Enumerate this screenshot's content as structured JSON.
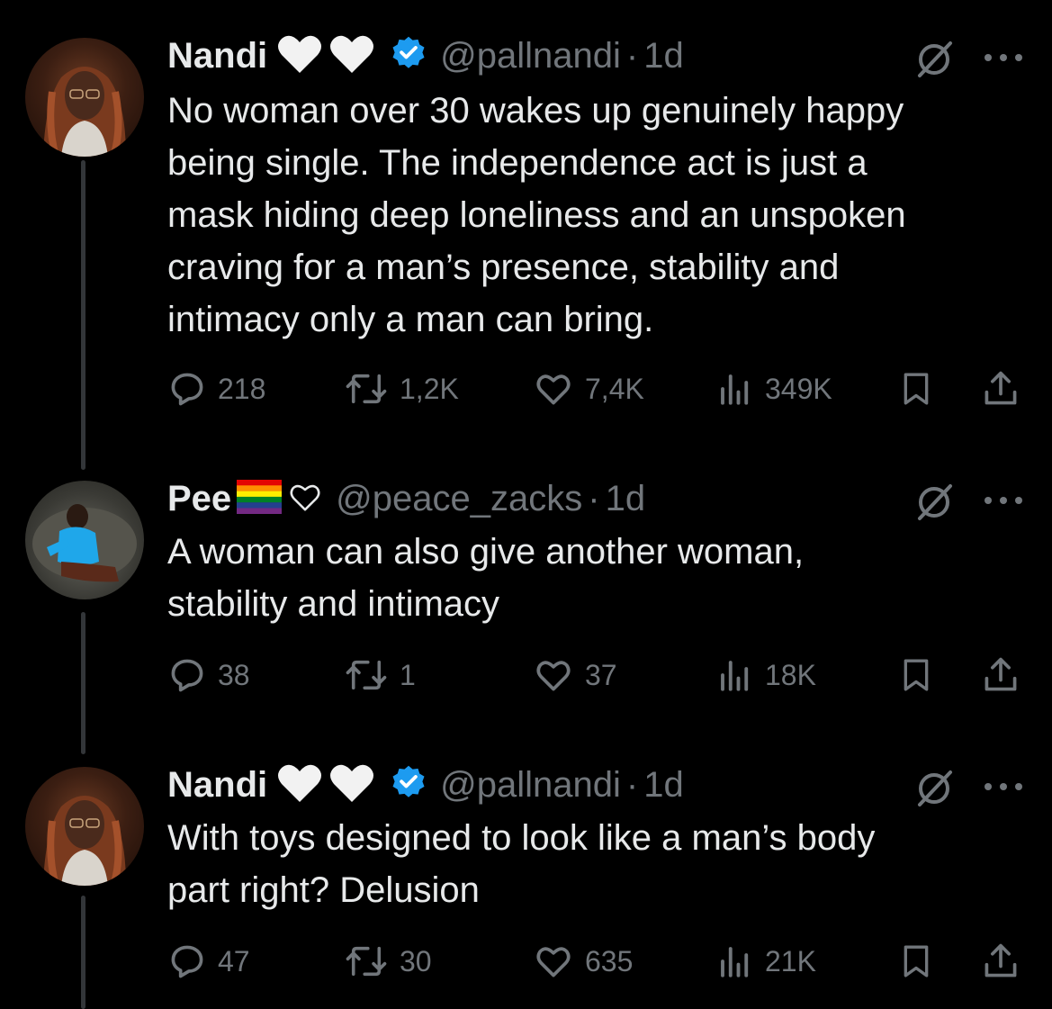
{
  "tweets": [
    {
      "author": "Nandi",
      "handle": "@pallnandi",
      "separator": "·",
      "time": "1d",
      "text": "No woman over 30 wakes up genuinely happy\nbeing single. The independence act is just a\nmask hiding deep loneliness and an unspoken\ncraving for a man’s presence, stability and\nintimacy only a man can bring.",
      "replies": "218",
      "reposts": "1,2K",
      "likes": "7,4K",
      "views": "349K",
      "verified": true
    },
    {
      "author": "Pee",
      "handle": "@peace_zacks",
      "separator": "·",
      "time": "1d",
      "text": "A woman can also give another woman,\nstability and intimacy",
      "replies": "38",
      "reposts": "1",
      "likes": "37",
      "views": "18K",
      "verified": false
    },
    {
      "author": "Nandi",
      "handle": "@pallnandi",
      "separator": "·",
      "time": "1d",
      "text": "With toys designed to look like a man’s body\npart right?  Delusion",
      "replies": "47",
      "reposts": "30",
      "likes": "635",
      "views": "21K",
      "verified": true
    }
  ],
  "colors": {
    "background": "#000000",
    "text": "#e7e9ea",
    "secondary": "#71767b",
    "verified": "#1d9bf0",
    "thread_line": "#333639"
  },
  "icons": [
    "reply-icon",
    "repost-icon",
    "like-icon",
    "views-icon",
    "bookmark-icon",
    "share-icon",
    "grok-icon",
    "more-icon",
    "verified-badge-icon",
    "white-heart-icon",
    "rainbow-flag-icon",
    "outline-heart-icon"
  ]
}
